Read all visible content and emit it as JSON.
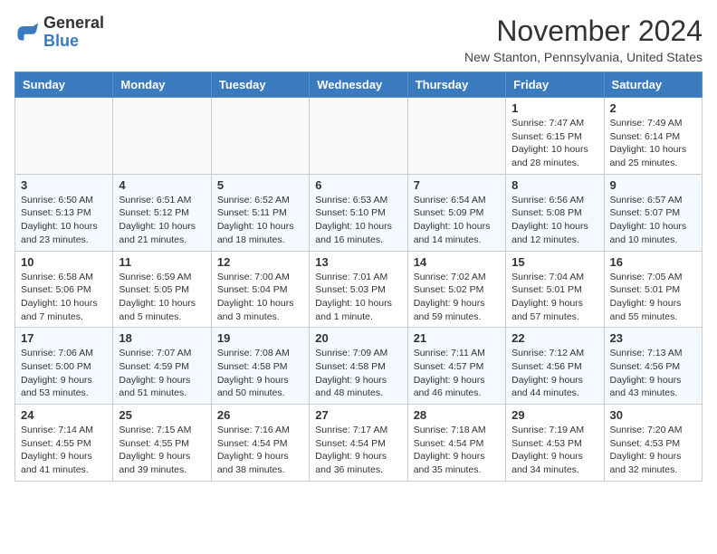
{
  "header": {
    "logo_general": "General",
    "logo_blue": "Blue",
    "month_title": "November 2024",
    "subtitle": "New Stanton, Pennsylvania, United States"
  },
  "weekdays": [
    "Sunday",
    "Monday",
    "Tuesday",
    "Wednesday",
    "Thursday",
    "Friday",
    "Saturday"
  ],
  "weeks": [
    [
      {
        "day": "",
        "info": ""
      },
      {
        "day": "",
        "info": ""
      },
      {
        "day": "",
        "info": ""
      },
      {
        "day": "",
        "info": ""
      },
      {
        "day": "",
        "info": ""
      },
      {
        "day": "1",
        "info": "Sunrise: 7:47 AM\nSunset: 6:15 PM\nDaylight: 10 hours and 28 minutes."
      },
      {
        "day": "2",
        "info": "Sunrise: 7:49 AM\nSunset: 6:14 PM\nDaylight: 10 hours and 25 minutes."
      }
    ],
    [
      {
        "day": "3",
        "info": "Sunrise: 6:50 AM\nSunset: 5:13 PM\nDaylight: 10 hours and 23 minutes."
      },
      {
        "day": "4",
        "info": "Sunrise: 6:51 AM\nSunset: 5:12 PM\nDaylight: 10 hours and 21 minutes."
      },
      {
        "day": "5",
        "info": "Sunrise: 6:52 AM\nSunset: 5:11 PM\nDaylight: 10 hours and 18 minutes."
      },
      {
        "day": "6",
        "info": "Sunrise: 6:53 AM\nSunset: 5:10 PM\nDaylight: 10 hours and 16 minutes."
      },
      {
        "day": "7",
        "info": "Sunrise: 6:54 AM\nSunset: 5:09 PM\nDaylight: 10 hours and 14 minutes."
      },
      {
        "day": "8",
        "info": "Sunrise: 6:56 AM\nSunset: 5:08 PM\nDaylight: 10 hours and 12 minutes."
      },
      {
        "day": "9",
        "info": "Sunrise: 6:57 AM\nSunset: 5:07 PM\nDaylight: 10 hours and 10 minutes."
      }
    ],
    [
      {
        "day": "10",
        "info": "Sunrise: 6:58 AM\nSunset: 5:06 PM\nDaylight: 10 hours and 7 minutes."
      },
      {
        "day": "11",
        "info": "Sunrise: 6:59 AM\nSunset: 5:05 PM\nDaylight: 10 hours and 5 minutes."
      },
      {
        "day": "12",
        "info": "Sunrise: 7:00 AM\nSunset: 5:04 PM\nDaylight: 10 hours and 3 minutes."
      },
      {
        "day": "13",
        "info": "Sunrise: 7:01 AM\nSunset: 5:03 PM\nDaylight: 10 hours and 1 minute."
      },
      {
        "day": "14",
        "info": "Sunrise: 7:02 AM\nSunset: 5:02 PM\nDaylight: 9 hours and 59 minutes."
      },
      {
        "day": "15",
        "info": "Sunrise: 7:04 AM\nSunset: 5:01 PM\nDaylight: 9 hours and 57 minutes."
      },
      {
        "day": "16",
        "info": "Sunrise: 7:05 AM\nSunset: 5:01 PM\nDaylight: 9 hours and 55 minutes."
      }
    ],
    [
      {
        "day": "17",
        "info": "Sunrise: 7:06 AM\nSunset: 5:00 PM\nDaylight: 9 hours and 53 minutes."
      },
      {
        "day": "18",
        "info": "Sunrise: 7:07 AM\nSunset: 4:59 PM\nDaylight: 9 hours and 51 minutes."
      },
      {
        "day": "19",
        "info": "Sunrise: 7:08 AM\nSunset: 4:58 PM\nDaylight: 9 hours and 50 minutes."
      },
      {
        "day": "20",
        "info": "Sunrise: 7:09 AM\nSunset: 4:58 PM\nDaylight: 9 hours and 48 minutes."
      },
      {
        "day": "21",
        "info": "Sunrise: 7:11 AM\nSunset: 4:57 PM\nDaylight: 9 hours and 46 minutes."
      },
      {
        "day": "22",
        "info": "Sunrise: 7:12 AM\nSunset: 4:56 PM\nDaylight: 9 hours and 44 minutes."
      },
      {
        "day": "23",
        "info": "Sunrise: 7:13 AM\nSunset: 4:56 PM\nDaylight: 9 hours and 43 minutes."
      }
    ],
    [
      {
        "day": "24",
        "info": "Sunrise: 7:14 AM\nSunset: 4:55 PM\nDaylight: 9 hours and 41 minutes."
      },
      {
        "day": "25",
        "info": "Sunrise: 7:15 AM\nSunset: 4:55 PM\nDaylight: 9 hours and 39 minutes."
      },
      {
        "day": "26",
        "info": "Sunrise: 7:16 AM\nSunset: 4:54 PM\nDaylight: 9 hours and 38 minutes."
      },
      {
        "day": "27",
        "info": "Sunrise: 7:17 AM\nSunset: 4:54 PM\nDaylight: 9 hours and 36 minutes."
      },
      {
        "day": "28",
        "info": "Sunrise: 7:18 AM\nSunset: 4:54 PM\nDaylight: 9 hours and 35 minutes."
      },
      {
        "day": "29",
        "info": "Sunrise: 7:19 AM\nSunset: 4:53 PM\nDaylight: 9 hours and 34 minutes."
      },
      {
        "day": "30",
        "info": "Sunrise: 7:20 AM\nSunset: 4:53 PM\nDaylight: 9 hours and 32 minutes."
      }
    ]
  ]
}
